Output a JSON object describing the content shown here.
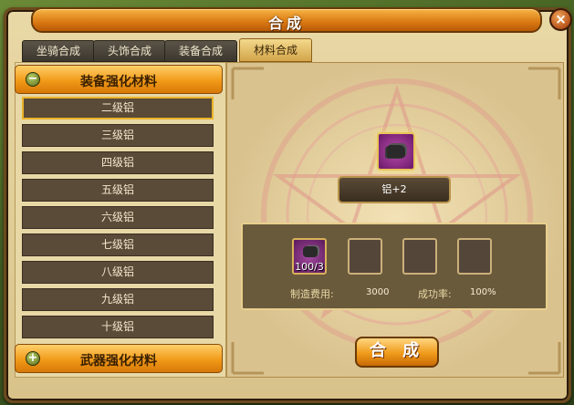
{
  "window": {
    "title": "合成",
    "close_icon": "×"
  },
  "tabs": [
    {
      "label": "坐骑合成",
      "active": false
    },
    {
      "label": "头饰合成",
      "active": false
    },
    {
      "label": "装备合成",
      "active": false
    },
    {
      "label": "材料合成",
      "active": true
    }
  ],
  "categories": {
    "equipment": {
      "toggle": "−",
      "label": "装备强化材料",
      "expanded": true
    },
    "weapon": {
      "toggle": "+",
      "label": "武器强化材料",
      "expanded": false
    }
  },
  "items": [
    "二级铝",
    "三级铝",
    "四级铝",
    "五级铝",
    "六级铝",
    "七级铝",
    "八级铝",
    "九级铝",
    "十级铝"
  ],
  "selected_index": 0,
  "target": {
    "name": "铝+2",
    "icon": "ore-icon"
  },
  "materials": {
    "slot1_count": "100/3"
  },
  "cost": {
    "label": "制造费用:",
    "value": "3000"
  },
  "rate": {
    "label": "成功率:",
    "value": "100%"
  },
  "compose_button": "合 成",
  "colors": {
    "accent_orange": "#f19a18",
    "panel": "#e7d8a6",
    "item_bg": "#5a4a38",
    "selected_border": "#e9b32a"
  }
}
